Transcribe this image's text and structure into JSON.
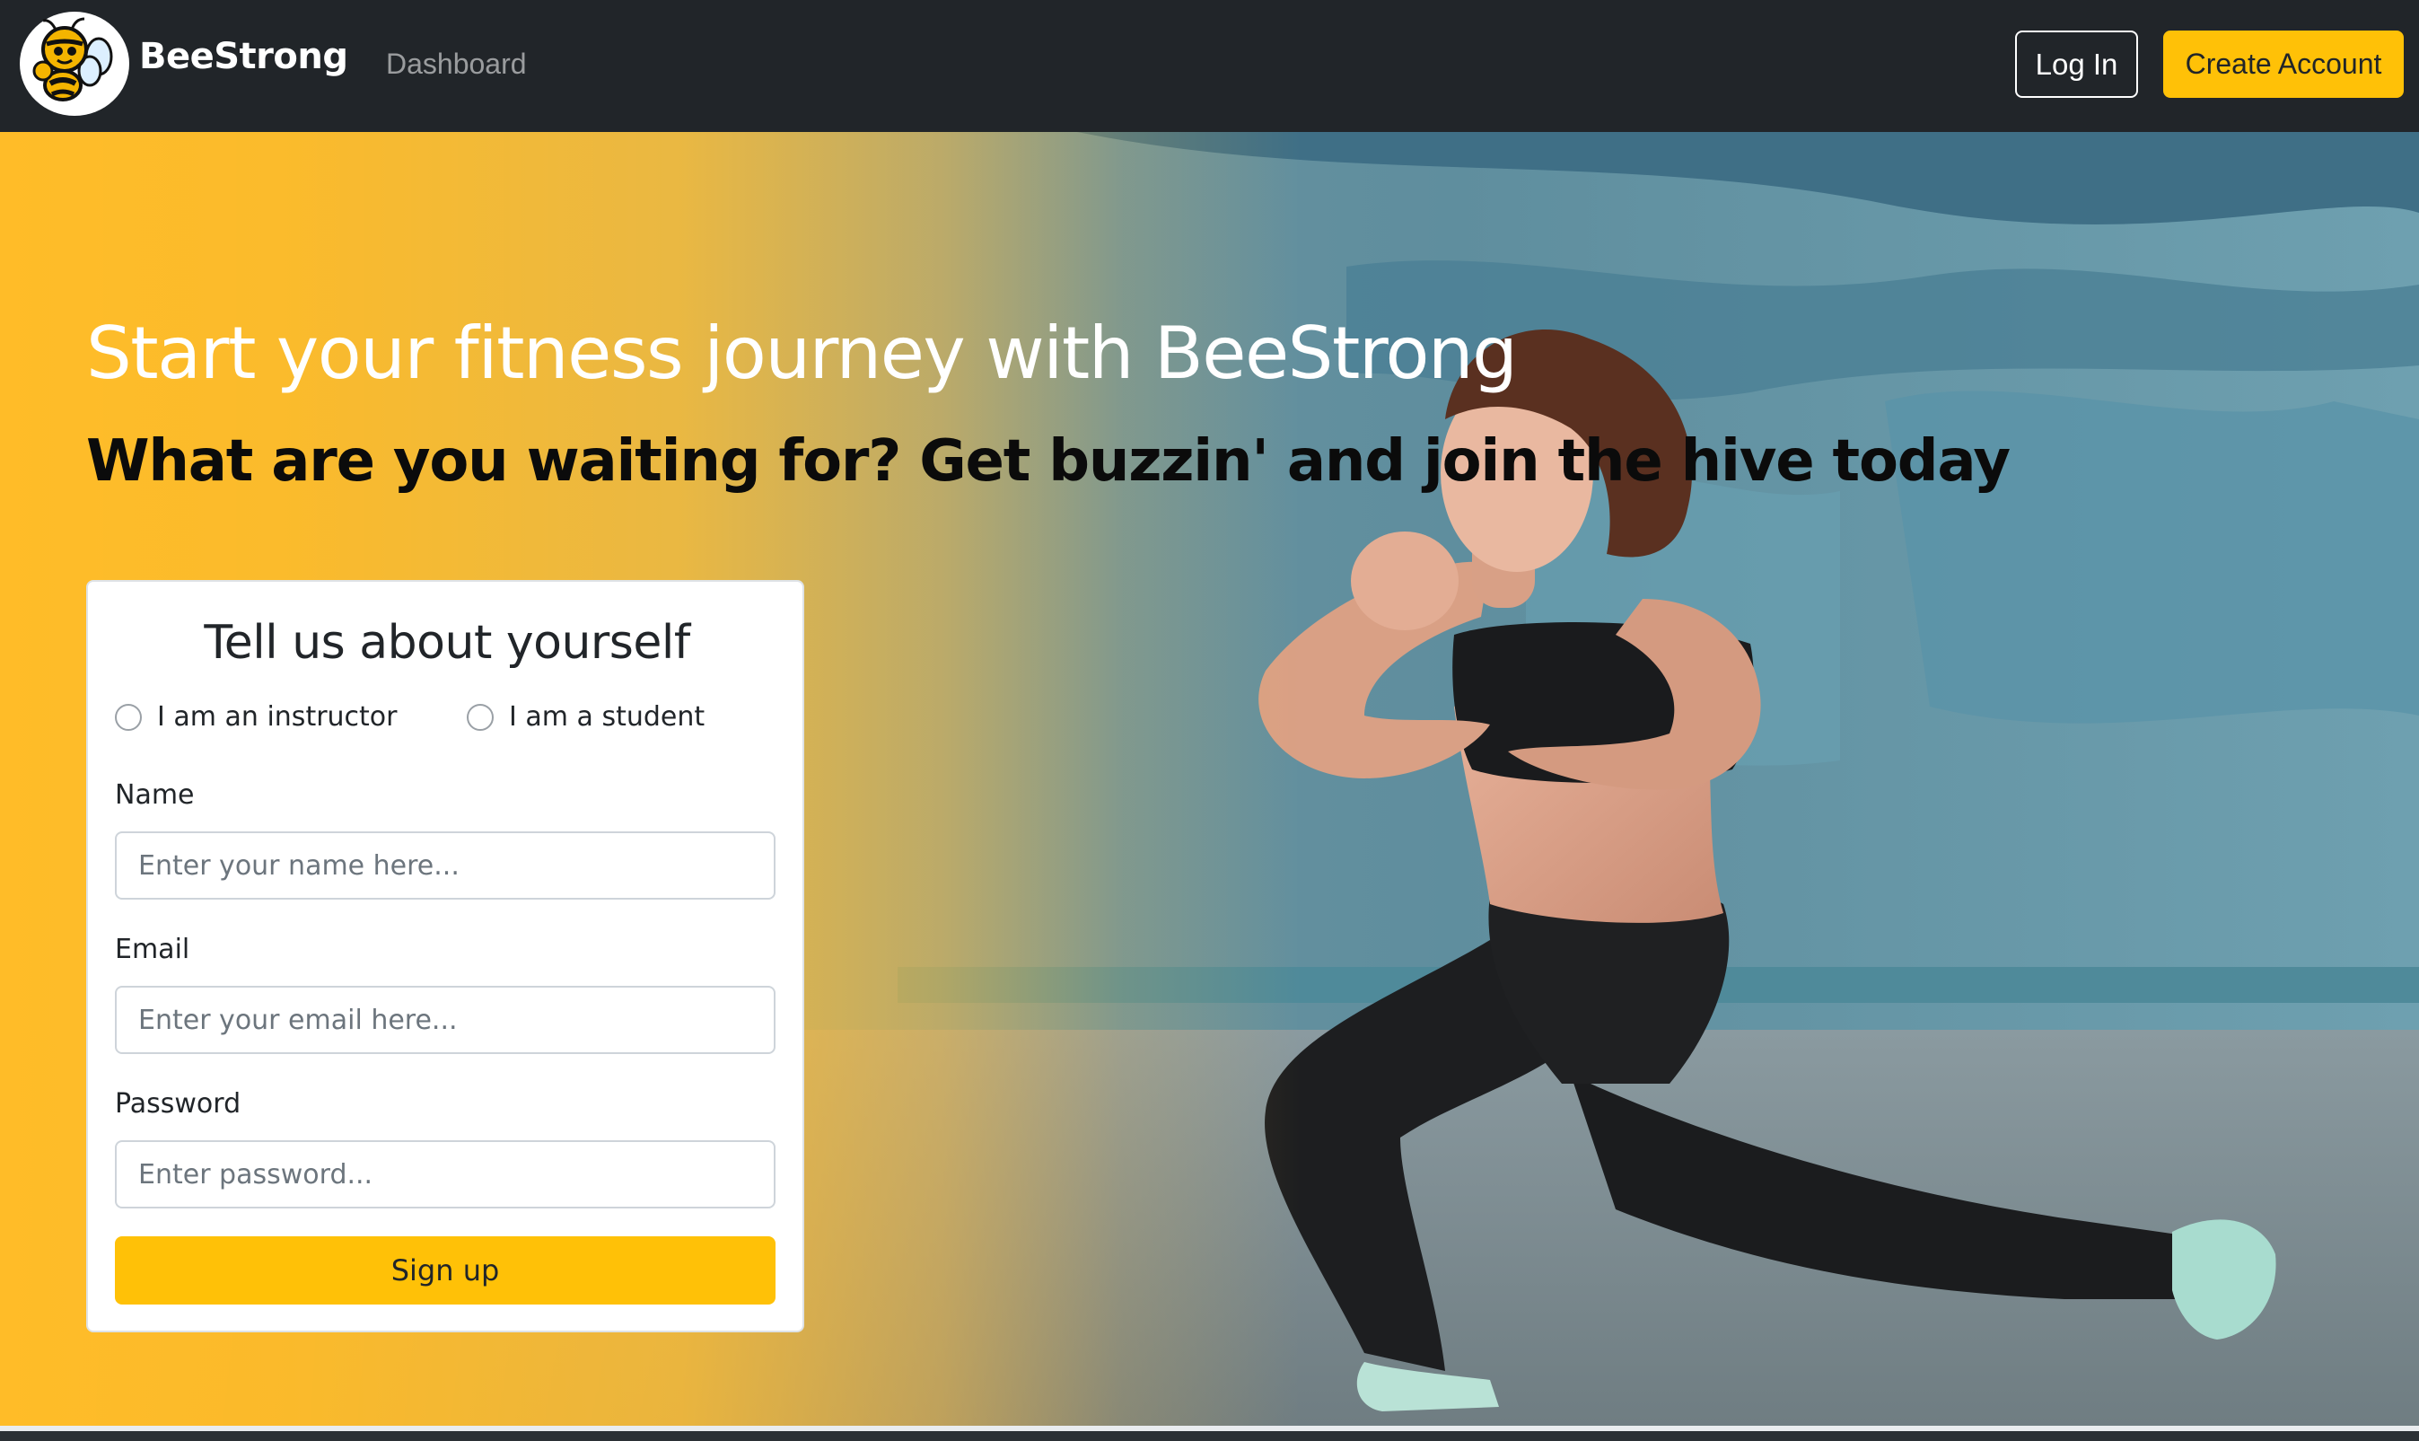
{
  "navbar": {
    "brand": "BeeStrong",
    "links": [
      {
        "label": "Dashboard"
      }
    ],
    "login_label": "Log In",
    "create_label": "Create Account"
  },
  "hero": {
    "title": "Start your fitness journey with BeeStrong",
    "subtitle": "What are you waiting for? Get buzzin' and join the hive today"
  },
  "form": {
    "title": "Tell us about yourself",
    "roles": [
      {
        "label": "I am an instructor",
        "checked": false
      },
      {
        "label": "I am a student",
        "checked": false
      }
    ],
    "fields": [
      {
        "label": "Name",
        "value": "",
        "placeholder": "Enter your name here..."
      },
      {
        "label": "Email",
        "value": "",
        "placeholder": "Enter your email here..."
      },
      {
        "label": "Password",
        "value": "",
        "placeholder": "Enter password..."
      }
    ],
    "submit_label": "Sign up"
  },
  "colors": {
    "navbar_bg": "#212529",
    "accent": "#ffc107",
    "hero_overlay": "#ffbc28"
  },
  "icons": {
    "logo": "bee-mascot-icon"
  }
}
